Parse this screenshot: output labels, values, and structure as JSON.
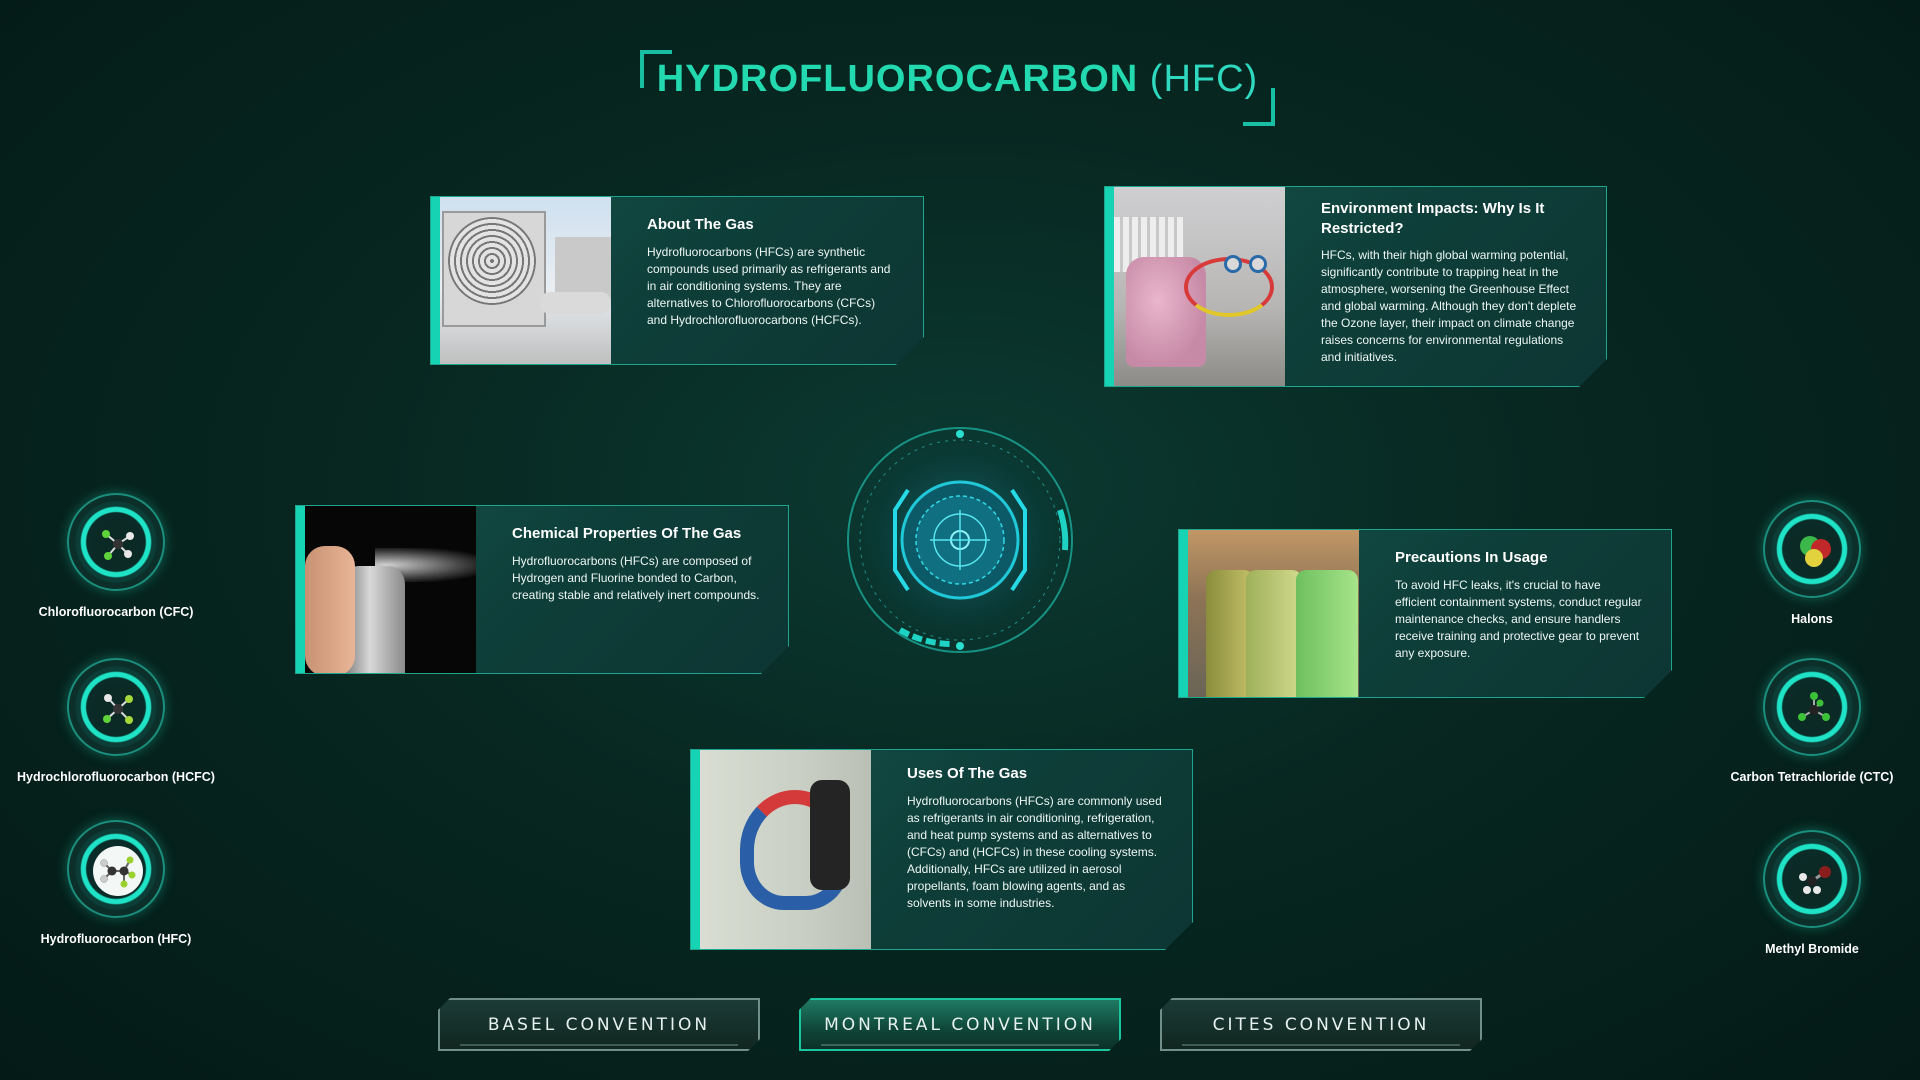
{
  "header": {
    "title_main": "HYDROFLUOROCARBON",
    "title_abbr": "(HFC)"
  },
  "cards": {
    "about": {
      "title": "About The Gas",
      "text": "Hydrofluorocarbons (HFCs) are synthetic compounds used primarily as refrigerants and in air conditioning systems. They are alternatives to Chlorofluorocarbons (CFCs) and Hydrochlorofluorocarbons (HCFCs)."
    },
    "environment": {
      "title": "Environment Impacts: Why Is It Restricted?",
      "text": "HFCs, with their high global warming potential, significantly contribute to trapping heat in the atmosphere, worsening the Greenhouse Effect and global warming. Although they don't deplete the Ozone layer, their impact on climate change raises concerns for environmental regulations and initiatives."
    },
    "chemical": {
      "title": "Chemical Properties Of The Gas",
      "text": "Hydrofluorocarbons (HFCs) are composed of Hydrogen and Fluorine bonded to Carbon, creating stable and relatively inert compounds."
    },
    "precautions": {
      "title": "Precautions In Usage",
      "text": "To avoid HFC leaks, it's crucial to have efficient containment systems, conduct regular maintenance checks, and ensure handlers receive training and protective gear to prevent any exposure."
    },
    "uses": {
      "title": "Uses Of The Gas",
      "text": "Hydrofluorocarbons (HFCs) are commonly used as refrigerants in air conditioning, refrigeration, and heat pump systems and as alternatives to (CFCs) and (HCFCs) in these cooling systems. Additionally, HFCs are utilized in aerosol propellants, foam blowing agents, and as solvents in some industries."
    }
  },
  "left_gases": [
    {
      "label": "Chlorofluorocarbon (CFC)",
      "icon": "cfc-molecule-icon",
      "active": false
    },
    {
      "label": "Hydrochlorofluorocarbon (HCFC)",
      "icon": "hcfc-molecule-icon",
      "active": false
    },
    {
      "label": "Hydrofluorocarbon (HFC)",
      "icon": "hfc-molecule-icon",
      "active": true
    }
  ],
  "right_gases": [
    {
      "label": "Halons",
      "icon": "halons-molecule-icon"
    },
    {
      "label": "Carbon Tetrachloride (CTC)",
      "icon": "ctc-molecule-icon"
    },
    {
      "label": "Methyl Bromide",
      "icon": "methyl-bromide-molecule-icon"
    }
  ],
  "conventions": [
    {
      "label": "BASEL CONVENTION",
      "active": false
    },
    {
      "label": "MONTREAL CONVENTION",
      "active": true
    },
    {
      "label": "CITES CONVENTION",
      "active": false
    }
  ],
  "colors": {
    "accent": "#22d9b0",
    "background": "#072720",
    "card": "#0e3e39"
  }
}
